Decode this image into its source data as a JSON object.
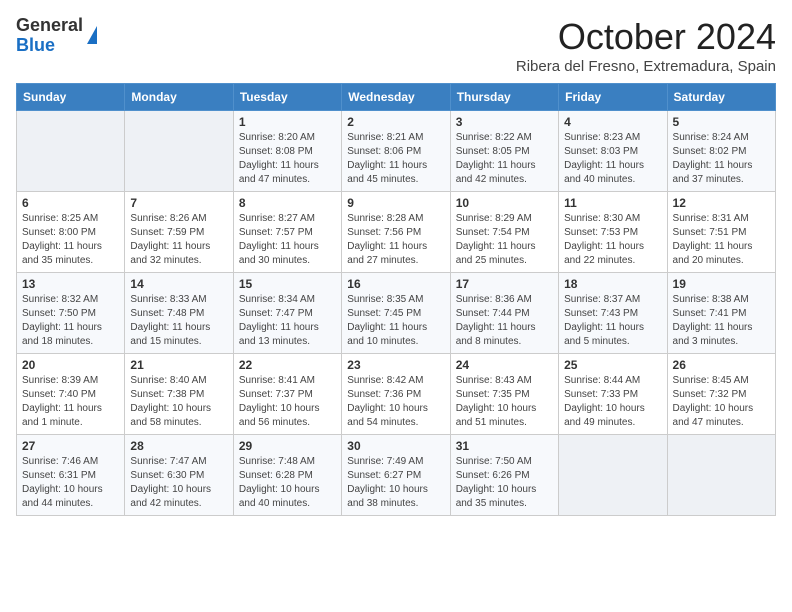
{
  "header": {
    "logo_general": "General",
    "logo_blue": "Blue",
    "month_title": "October 2024",
    "location": "Ribera del Fresno, Extremadura, Spain"
  },
  "weekdays": [
    "Sunday",
    "Monday",
    "Tuesday",
    "Wednesday",
    "Thursday",
    "Friday",
    "Saturday"
  ],
  "weeks": [
    [
      {
        "day": "",
        "info": ""
      },
      {
        "day": "",
        "info": ""
      },
      {
        "day": "1",
        "info": "Sunrise: 8:20 AM\nSunset: 8:08 PM\nDaylight: 11 hours and 47 minutes."
      },
      {
        "day": "2",
        "info": "Sunrise: 8:21 AM\nSunset: 8:06 PM\nDaylight: 11 hours and 45 minutes."
      },
      {
        "day": "3",
        "info": "Sunrise: 8:22 AM\nSunset: 8:05 PM\nDaylight: 11 hours and 42 minutes."
      },
      {
        "day": "4",
        "info": "Sunrise: 8:23 AM\nSunset: 8:03 PM\nDaylight: 11 hours and 40 minutes."
      },
      {
        "day": "5",
        "info": "Sunrise: 8:24 AM\nSunset: 8:02 PM\nDaylight: 11 hours and 37 minutes."
      }
    ],
    [
      {
        "day": "6",
        "info": "Sunrise: 8:25 AM\nSunset: 8:00 PM\nDaylight: 11 hours and 35 minutes."
      },
      {
        "day": "7",
        "info": "Sunrise: 8:26 AM\nSunset: 7:59 PM\nDaylight: 11 hours and 32 minutes."
      },
      {
        "day": "8",
        "info": "Sunrise: 8:27 AM\nSunset: 7:57 PM\nDaylight: 11 hours and 30 minutes."
      },
      {
        "day": "9",
        "info": "Sunrise: 8:28 AM\nSunset: 7:56 PM\nDaylight: 11 hours and 27 minutes."
      },
      {
        "day": "10",
        "info": "Sunrise: 8:29 AM\nSunset: 7:54 PM\nDaylight: 11 hours and 25 minutes."
      },
      {
        "day": "11",
        "info": "Sunrise: 8:30 AM\nSunset: 7:53 PM\nDaylight: 11 hours and 22 minutes."
      },
      {
        "day": "12",
        "info": "Sunrise: 8:31 AM\nSunset: 7:51 PM\nDaylight: 11 hours and 20 minutes."
      }
    ],
    [
      {
        "day": "13",
        "info": "Sunrise: 8:32 AM\nSunset: 7:50 PM\nDaylight: 11 hours and 18 minutes."
      },
      {
        "day": "14",
        "info": "Sunrise: 8:33 AM\nSunset: 7:48 PM\nDaylight: 11 hours and 15 minutes."
      },
      {
        "day": "15",
        "info": "Sunrise: 8:34 AM\nSunset: 7:47 PM\nDaylight: 11 hours and 13 minutes."
      },
      {
        "day": "16",
        "info": "Sunrise: 8:35 AM\nSunset: 7:45 PM\nDaylight: 11 hours and 10 minutes."
      },
      {
        "day": "17",
        "info": "Sunrise: 8:36 AM\nSunset: 7:44 PM\nDaylight: 11 hours and 8 minutes."
      },
      {
        "day": "18",
        "info": "Sunrise: 8:37 AM\nSunset: 7:43 PM\nDaylight: 11 hours and 5 minutes."
      },
      {
        "day": "19",
        "info": "Sunrise: 8:38 AM\nSunset: 7:41 PM\nDaylight: 11 hours and 3 minutes."
      }
    ],
    [
      {
        "day": "20",
        "info": "Sunrise: 8:39 AM\nSunset: 7:40 PM\nDaylight: 11 hours and 1 minute."
      },
      {
        "day": "21",
        "info": "Sunrise: 8:40 AM\nSunset: 7:38 PM\nDaylight: 10 hours and 58 minutes."
      },
      {
        "day": "22",
        "info": "Sunrise: 8:41 AM\nSunset: 7:37 PM\nDaylight: 10 hours and 56 minutes."
      },
      {
        "day": "23",
        "info": "Sunrise: 8:42 AM\nSunset: 7:36 PM\nDaylight: 10 hours and 54 minutes."
      },
      {
        "day": "24",
        "info": "Sunrise: 8:43 AM\nSunset: 7:35 PM\nDaylight: 10 hours and 51 minutes."
      },
      {
        "day": "25",
        "info": "Sunrise: 8:44 AM\nSunset: 7:33 PM\nDaylight: 10 hours and 49 minutes."
      },
      {
        "day": "26",
        "info": "Sunrise: 8:45 AM\nSunset: 7:32 PM\nDaylight: 10 hours and 47 minutes."
      }
    ],
    [
      {
        "day": "27",
        "info": "Sunrise: 7:46 AM\nSunset: 6:31 PM\nDaylight: 10 hours and 44 minutes."
      },
      {
        "day": "28",
        "info": "Sunrise: 7:47 AM\nSunset: 6:30 PM\nDaylight: 10 hours and 42 minutes."
      },
      {
        "day": "29",
        "info": "Sunrise: 7:48 AM\nSunset: 6:28 PM\nDaylight: 10 hours and 40 minutes."
      },
      {
        "day": "30",
        "info": "Sunrise: 7:49 AM\nSunset: 6:27 PM\nDaylight: 10 hours and 38 minutes."
      },
      {
        "day": "31",
        "info": "Sunrise: 7:50 AM\nSunset: 6:26 PM\nDaylight: 10 hours and 35 minutes."
      },
      {
        "day": "",
        "info": ""
      },
      {
        "day": "",
        "info": ""
      }
    ]
  ]
}
